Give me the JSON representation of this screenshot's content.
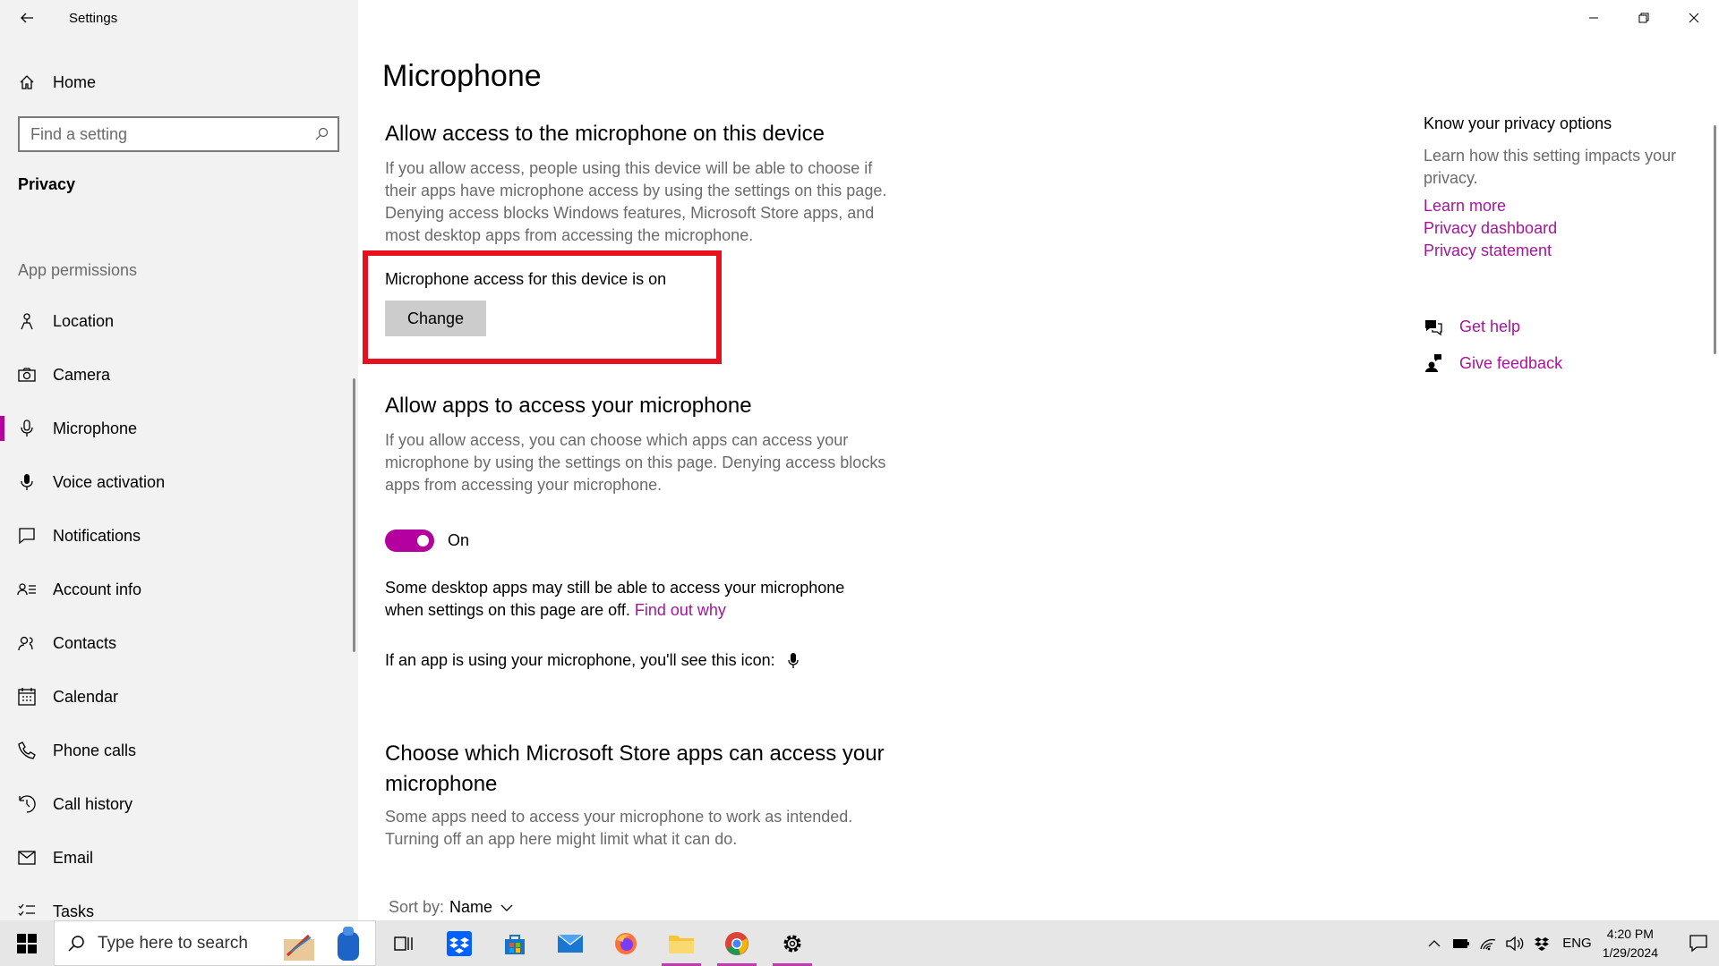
{
  "window": {
    "app_title": "Settings",
    "controls": [
      "minimize",
      "restore",
      "close"
    ]
  },
  "sidebar": {
    "home_label": "Home",
    "search_placeholder": "Find a setting",
    "category": "Privacy",
    "section_label": "App permissions",
    "items": [
      {
        "label": "Location",
        "icon": "location-icon"
      },
      {
        "label": "Camera",
        "icon": "camera-icon"
      },
      {
        "label": "Microphone",
        "icon": "microphone-icon",
        "selected": true
      },
      {
        "label": "Voice activation",
        "icon": "voice-activation-icon"
      },
      {
        "label": "Notifications",
        "icon": "notifications-icon"
      },
      {
        "label": "Account info",
        "icon": "account-info-icon"
      },
      {
        "label": "Contacts",
        "icon": "contacts-icon"
      },
      {
        "label": "Calendar",
        "icon": "calendar-icon"
      },
      {
        "label": "Phone calls",
        "icon": "phone-icon"
      },
      {
        "label": "Call history",
        "icon": "call-history-icon"
      },
      {
        "label": "Email",
        "icon": "email-icon"
      },
      {
        "label": "Tasks",
        "icon": "tasks-icon"
      }
    ]
  },
  "main": {
    "title": "Microphone",
    "device_section": {
      "heading": "Allow access to the microphone on this device",
      "description": "If you allow access, people using this device will be able to choose if their apps have microphone access by using the settings on this page. Denying access blocks Windows features, Microsoft Store apps, and most desktop apps from accessing the microphone.",
      "status": "Microphone access for this device is on",
      "change_button": "Change"
    },
    "apps_section": {
      "heading": "Allow apps to access your microphone",
      "description": "If you allow access, you can choose which apps can access your microphone by using the settings on this page. Denying access blocks apps from accessing your microphone.",
      "toggle_state": "On",
      "note": "Some desktop apps may still be able to access your microphone when settings on this page are off.",
      "note_link": "Find out why",
      "icon_note": "If an app is using your microphone, you'll see this icon:"
    },
    "store_section": {
      "heading": "Choose which Microsoft Store apps can access your microphone",
      "description": "Some apps need to access your microphone to work as intended. Turning off an app here might limit what it can do.",
      "sort_label": "Sort by:",
      "sort_value": "Name"
    }
  },
  "right_panel": {
    "title": "Know your privacy options",
    "description": "Learn how this setting impacts your privacy.",
    "links": [
      "Learn more",
      "Privacy dashboard",
      "Privacy statement"
    ],
    "help": [
      {
        "label": "Get help",
        "icon": "get-help-icon"
      },
      {
        "label": "Give feedback",
        "icon": "give-feedback-icon"
      }
    ]
  },
  "taskbar": {
    "search_placeholder": "Type here to search",
    "apps": [
      {
        "name": "task-view",
        "running": false
      },
      {
        "name": "dropbox",
        "running": false
      },
      {
        "name": "microsoft-store",
        "running": false
      },
      {
        "name": "mail",
        "running": false
      },
      {
        "name": "firefox",
        "running": false
      },
      {
        "name": "file-explorer",
        "running": true
      },
      {
        "name": "chrome",
        "running": true
      },
      {
        "name": "settings",
        "running": true
      }
    ],
    "tray": {
      "language": "ENG",
      "time": "4:20 PM",
      "date": "1/29/2024"
    }
  },
  "colors": {
    "accent": "#b4009e",
    "link": "#a7149b",
    "highlight_box": "#e8101e",
    "sidebar_bg": "#f2f2f2",
    "taskbar_bg": "#e6e6e6"
  }
}
